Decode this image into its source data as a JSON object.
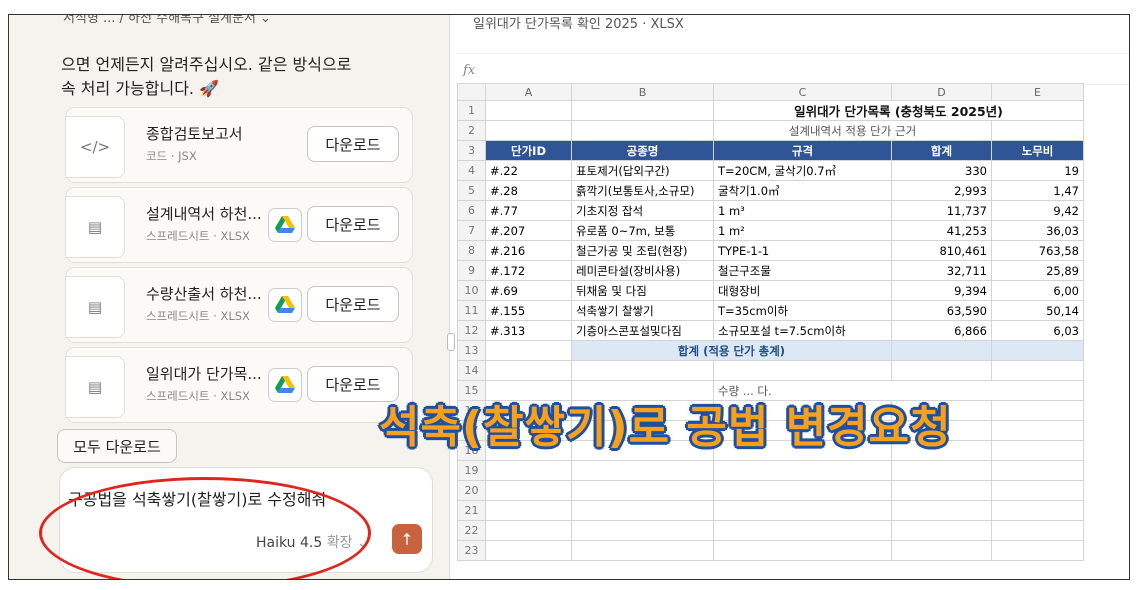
{
  "chat": {
    "top_cut": "서식형 ... / 하천 수해복구 설계문서  ⌄",
    "message_line1": "으면 언제든지 알려주십시오. 같은 방식으로",
    "message_line2": "속 처리 가능합니다. 🚀",
    "files": [
      {
        "title": "종합검토보고서",
        "subtitle": "코드 · JSX",
        "icon": "code-icon",
        "has_drive": false,
        "download_label": "다운로드"
      },
      {
        "title": "설계내역서 하천...",
        "subtitle": "스프레드시트 · XLSX",
        "icon": "spreadsheet-icon",
        "has_drive": true,
        "download_label": "다운로드"
      },
      {
        "title": "수량산출서 하천...",
        "subtitle": "스프레드시트 · XLSX",
        "icon": "spreadsheet-icon",
        "has_drive": true,
        "download_label": "다운로드"
      },
      {
        "title": "일위대가 단가목...",
        "subtitle": "스프레드시트 · XLSX",
        "icon": "spreadsheet-icon",
        "has_drive": true,
        "download_label": "다운로드"
      }
    ],
    "download_all_label": "모두 다운로드",
    "input_text": "구공법을 석축쌓기(찰쌓기)로 수정해줘",
    "model_label": "Haiku 4.5",
    "extended_label": "확장",
    "send_icon": "arrow-up-icon"
  },
  "sheet": {
    "doc_title": "일위대가 단가목록 확인 2025 · XLSX",
    "fx_label": "fx",
    "columns": [
      "A",
      "B",
      "C",
      "D",
      "E"
    ],
    "title": "일위대가 단가목록 (충청북도 2025년)",
    "subtitle": "설계내역서 적용 단가 근거",
    "headers": [
      "단가ID",
      "공종명",
      "규격",
      "합계",
      "노무비"
    ],
    "rows": [
      {
        "n": "4",
        "id": "#.22",
        "name": "표토제거(답외구간)",
        "spec": "T=20CM, 굴삭기0.7㎥",
        "total": "330",
        "labor": "19"
      },
      {
        "n": "5",
        "id": "#.28",
        "name": "흙깍기(보통토사,소규모)",
        "spec": "굴착기1.0㎥",
        "total": "2,993",
        "labor": "1,47"
      },
      {
        "n": "6",
        "id": "#.77",
        "name": "기초지정 잡석",
        "spec": "1 m³",
        "total": "11,737",
        "labor": "9,42"
      },
      {
        "n": "7",
        "id": "#.207",
        "name": "유로폼 0~7m, 보통",
        "spec": "1 m²",
        "total": "41,253",
        "labor": "36,03"
      },
      {
        "n": "8",
        "id": "#.216",
        "name": "철근가공 및 조립(현장)",
        "spec": "TYPE-1-1",
        "total": "810,461",
        "labor": "763,58"
      },
      {
        "n": "9",
        "id": "#.172",
        "name": "레미콘타설(장비사용)",
        "spec": "철근구조물",
        "total": "32,711",
        "labor": "25,89"
      },
      {
        "n": "10",
        "id": "#.69",
        "name": "뒤채움 및 다짐",
        "spec": "대형장비",
        "total": "9,394",
        "labor": "6,00"
      },
      {
        "n": "11",
        "id": "#.155",
        "name": "석축쌓기 찰쌓기",
        "spec": "T=35cm이하",
        "total": "63,590",
        "labor": "50,14"
      },
      {
        "n": "12",
        "id": "#.313",
        "name": "기층아스콘포설및다짐",
        "spec": "소규모포설 t=7.5cm이하",
        "total": "6,866",
        "labor": "6,03"
      }
    ],
    "total_label": "합계 (적용 단가 총계)",
    "row15_text": "수량 ... 다.",
    "empty_rows": [
      "14",
      "15",
      "16",
      "17",
      "18",
      "19",
      "20",
      "21",
      "22",
      "23"
    ]
  },
  "overlay": {
    "caption": "석축(찰쌓기)로 공법 변경요청",
    "caption_color": "#f7a11a",
    "ellipse_color": "#e0261c"
  }
}
